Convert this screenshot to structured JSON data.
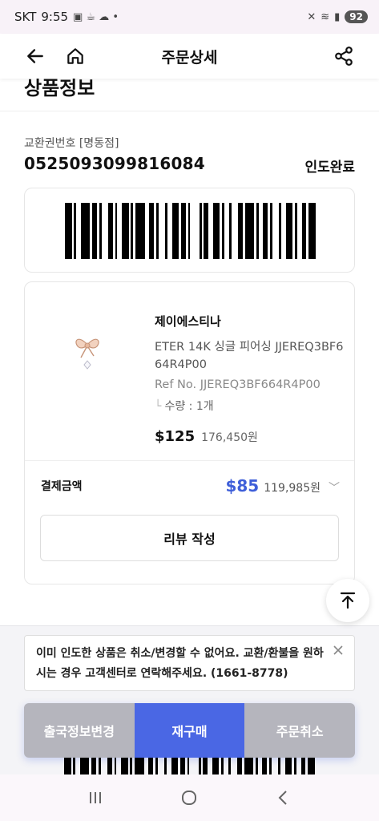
{
  "status_bar": {
    "carrier": "SKT",
    "time": "9:55",
    "battery": "92"
  },
  "header": {
    "title": "주문상세"
  },
  "section": {
    "title": "상품정보"
  },
  "voucher": {
    "label": "교환권번호 [명동점]",
    "number": "0525093099816084",
    "status": "인도완료"
  },
  "product": {
    "brand": "제이에스티나",
    "name": "ETER 14K 싱글 피어싱 JJEREQ3BF664R4P00",
    "ref_no": "Ref No. JJEREQ3BF664R4P00",
    "quantity": "수량 : 1개",
    "price_usd": "$125",
    "price_krw": "176,450원"
  },
  "payment": {
    "label": "결제금액",
    "amount_usd": "$85",
    "amount_krw": "119,985원",
    "accent_color": "#3f5fd9"
  },
  "review_button": "리뷰 작성",
  "notice": {
    "text": "이미 인도한 상품은 취소/변경할 수 없어요. 교환/환불을 원하시는 경우 고객센터로 연락해주세요. (1661-8778)"
  },
  "actions": {
    "change_departure": "출국정보변경",
    "reorder": "재구매",
    "cancel_order": "주문취소",
    "primary_color": "#4a67e4"
  },
  "icons": [
    "back-arrow-icon",
    "home-icon",
    "share-icon",
    "scroll-top-icon",
    "close-icon",
    "chevron-down-icon",
    "recent-apps-icon",
    "home-nav-icon",
    "back-nav-icon"
  ]
}
